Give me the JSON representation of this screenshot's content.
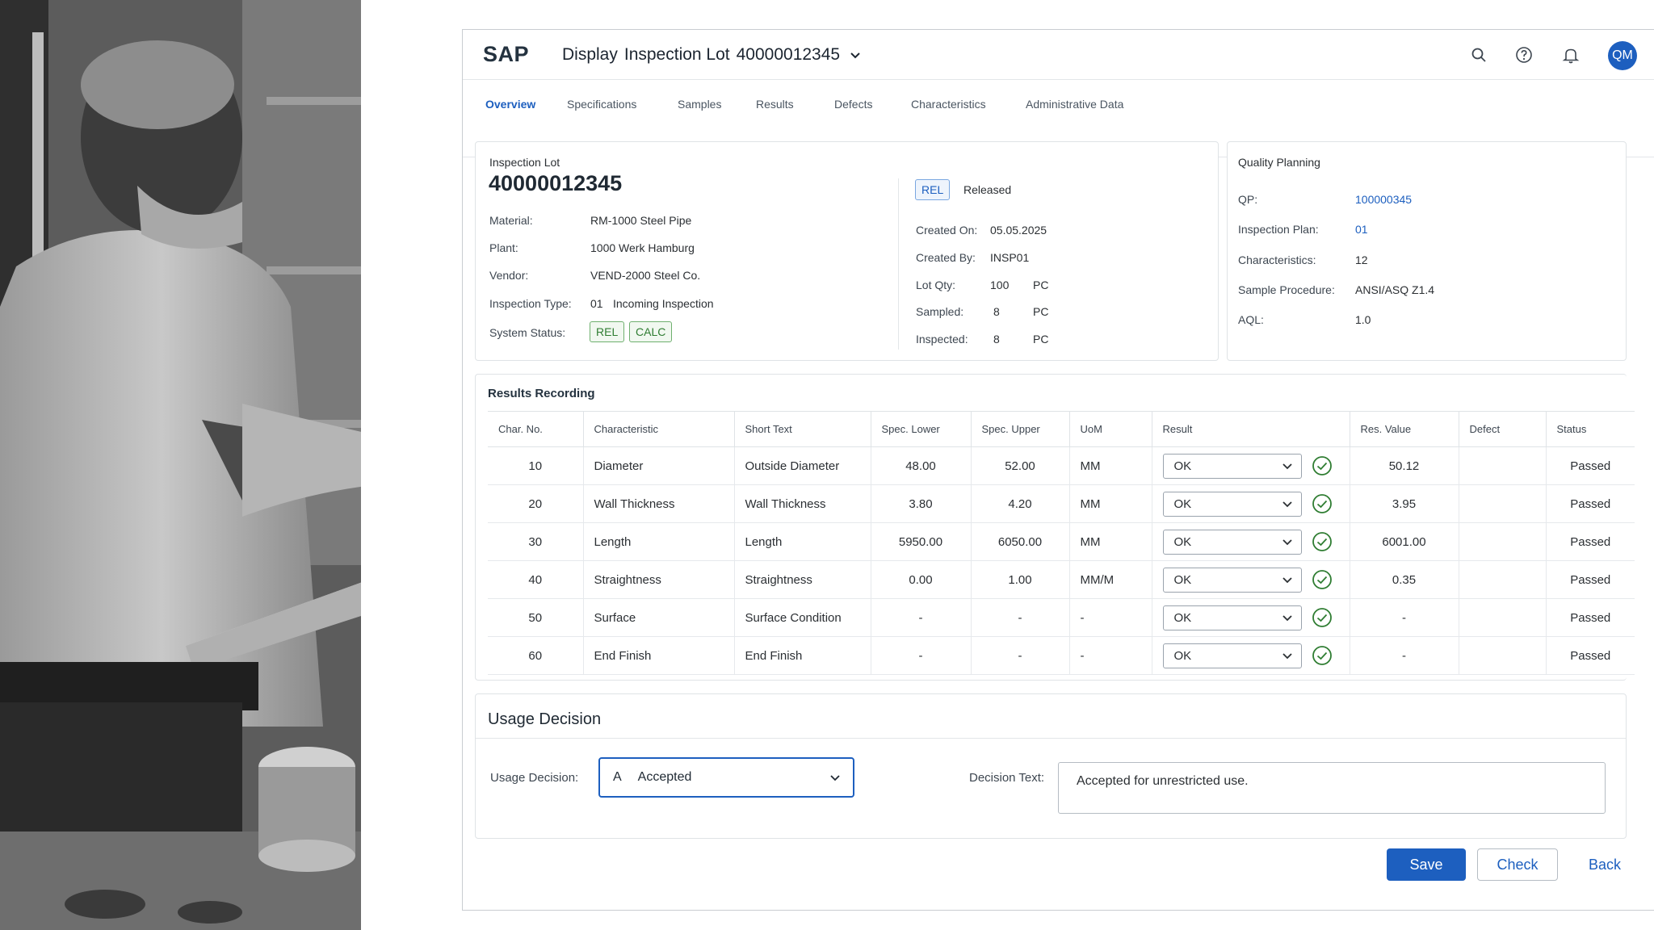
{
  "shell": {
    "logo": "SAP",
    "title_prefix": "Display",
    "title_object": "Inspection Lot",
    "title_number": "40000012345",
    "avatar_initials": "QM",
    "icons": [
      "search-icon",
      "help-icon",
      "bell-icon",
      "chevron-down-icon"
    ]
  },
  "tabs": [
    "Overview",
    "Specifications",
    "Samples",
    "Results",
    "Defects",
    "Characteristics",
    "Administrative Data"
  ],
  "lot": {
    "heading": "Inspection Lot",
    "number": "40000012345",
    "fields": [
      {
        "label": "Material:",
        "value": "RM-1000 Steel Pipe"
      },
      {
        "label": "Plant:",
        "value": "1000 Werk Hamburg"
      },
      {
        "label": "Vendor:",
        "value": "VEND-2000 Steel Co."
      },
      {
        "label": "Inspection Type:",
        "value": "01",
        "extra": "Incoming Inspection"
      }
    ],
    "system_status_label": "System Status:",
    "system_status": [
      "REL",
      "CALC"
    ],
    "status_badge": "REL",
    "status_text": "Released",
    "meta": [
      {
        "label": "Created On:",
        "value": "05.05.2025"
      },
      {
        "label": "Created By:",
        "value": "INSP01"
      },
      {
        "label": "Lot Qty:",
        "value": "100",
        "unit": "PC"
      },
      {
        "label": "Sampled:",
        "value": "8",
        "unit": "PC"
      },
      {
        "label": "Inspected:",
        "value": "8",
        "unit": "PC"
      }
    ]
  },
  "planning": {
    "heading": "Quality Planning",
    "fields": [
      {
        "label": "QP:",
        "value": "100000345"
      },
      {
        "label": "Inspection Plan:",
        "value": "01"
      },
      {
        "label": "Characteristics:",
        "value": "12"
      },
      {
        "label": "Sample Procedure:",
        "value": "ANSI/ASQ Z1.4"
      },
      {
        "label": "AQL:",
        "value": "1.0"
      }
    ]
  },
  "results": {
    "heading": "Results Recording",
    "columns": [
      "Char. No.",
      "Characteristic",
      "Short Text",
      "Spec. Lower",
      "Spec. Upper",
      "UoM",
      "Result",
      "Res. Value",
      "Defect",
      "Status"
    ],
    "rows": [
      {
        "no": "10",
        "characteristic": "Diameter",
        "short_text": "Outside Diameter",
        "lower": "48.00",
        "upper": "52.00",
        "uom": "MM",
        "result": "OK",
        "value": "50.12",
        "defect": "",
        "status": "Passed"
      },
      {
        "no": "20",
        "characteristic": "Wall Thickness",
        "short_text": "Wall Thickness",
        "lower": "3.80",
        "upper": "4.20",
        "uom": "MM",
        "result": "OK",
        "value": "3.95",
        "defect": "",
        "status": "Passed"
      },
      {
        "no": "30",
        "characteristic": "Length",
        "short_text": "Length",
        "lower": "5950.00",
        "upper": "6050.00",
        "uom": "MM",
        "result": "OK",
        "value": "6001.00",
        "defect": "",
        "status": "Passed"
      },
      {
        "no": "40",
        "characteristic": "Straightness",
        "short_text": "Straightness",
        "lower": "0.00",
        "upper": "1.00",
        "uom": "MM/M",
        "result": "OK",
        "value": "0.35",
        "defect": "",
        "status": "Passed"
      },
      {
        "no": "50",
        "characteristic": "Surface",
        "short_text": "Surface Condition",
        "lower": "-",
        "upper": "-",
        "uom": "-",
        "result": "OK",
        "value": "-",
        "defect": "",
        "status": "Passed"
      },
      {
        "no": "60",
        "characteristic": "End Finish",
        "short_text": "End Finish",
        "lower": "-",
        "upper": "-",
        "uom": "-",
        "result": "OK",
        "value": "-",
        "defect": "",
        "status": "Passed"
      }
    ]
  },
  "usage_decision": {
    "heading": "Usage Decision",
    "label": "Usage Decision:",
    "code": "A",
    "value": "Accepted",
    "text_label": "Decision Text:",
    "text": "Accepted for unrestricted use."
  },
  "actions": {
    "save": "Save",
    "check": "Check",
    "back": "Back"
  },
  "colors": {
    "accent": "#1d5fbf",
    "success": "#2f7d32",
    "border": "#dfe3e6"
  }
}
